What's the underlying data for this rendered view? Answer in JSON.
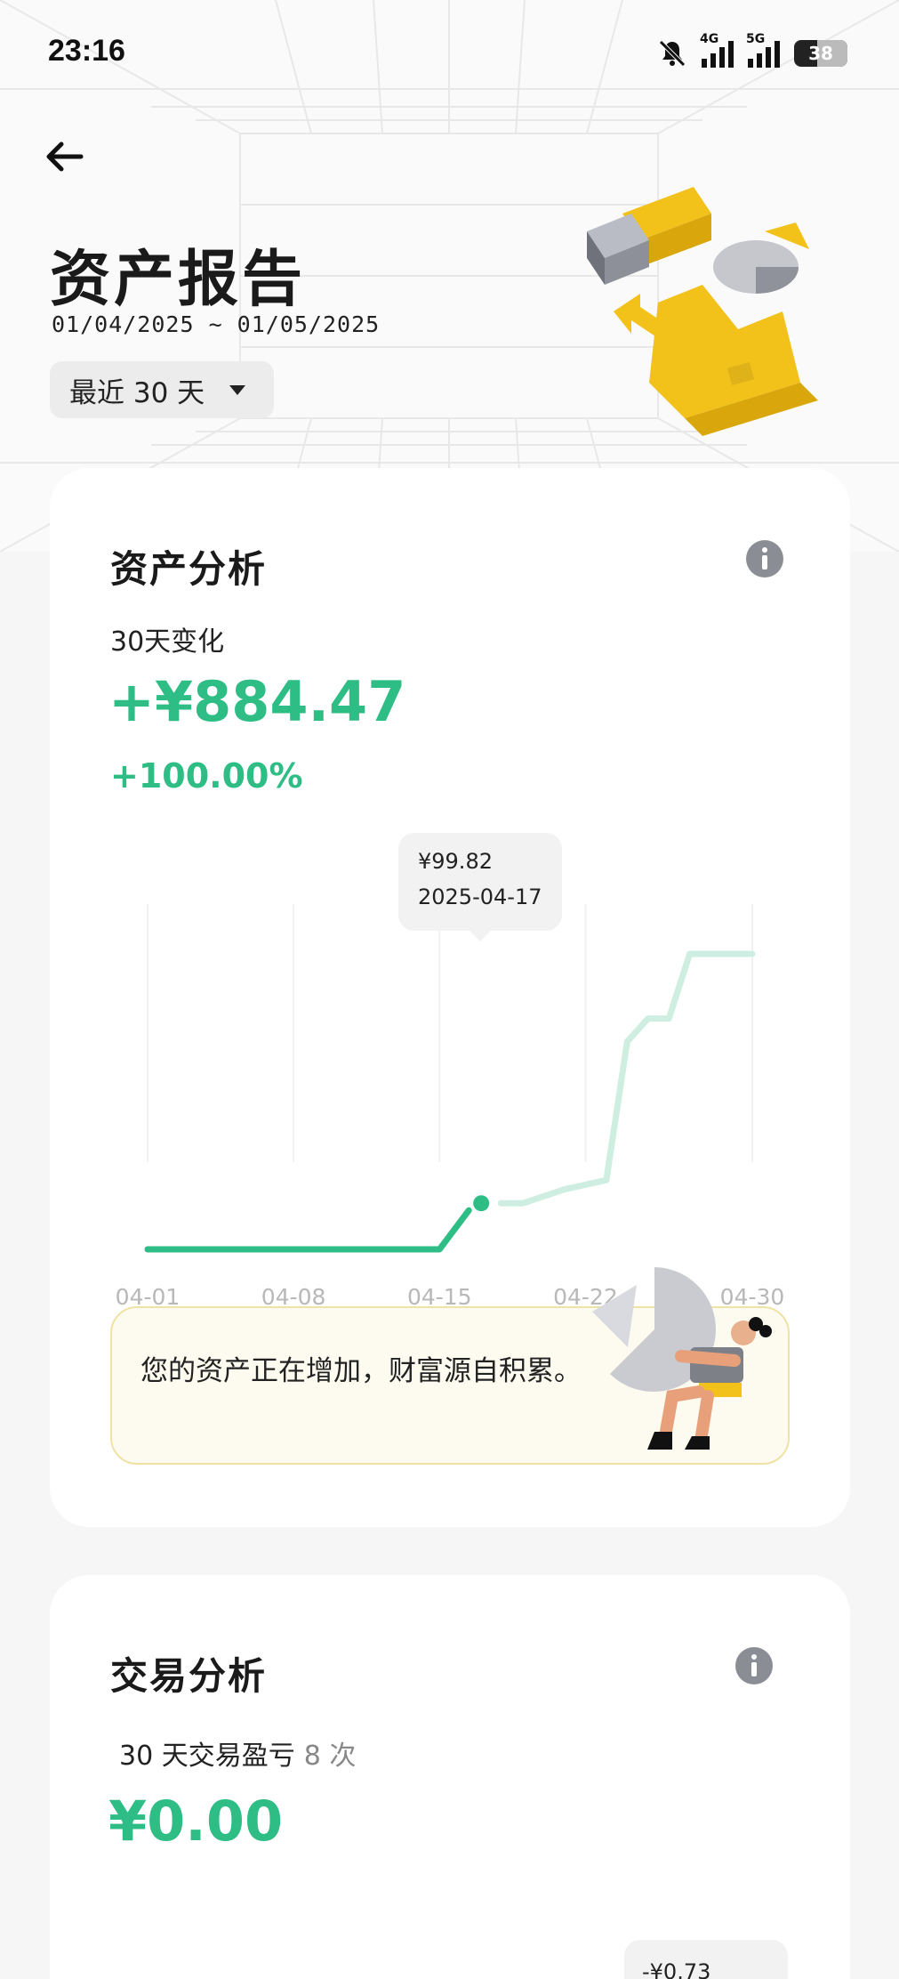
{
  "status_bar": {
    "time": "23:16",
    "network_1": "4G",
    "network_2": "5G",
    "battery": "38",
    "icons": [
      "bell-muted-icon",
      "signal-icon",
      "signal-icon",
      "battery-icon"
    ]
  },
  "header": {
    "back_icon": "arrow-left-icon",
    "title": "资产报告",
    "date_range": "01/04/2025 ~ 01/05/2025",
    "period_selector": "最近 30 天"
  },
  "asset_analysis": {
    "title": "资产分析",
    "change_label": "30天变化",
    "change_amount": "+¥884.47",
    "change_percent": "+100.00%",
    "tooltip": {
      "value": "¥99.82",
      "date": "2025-04-17"
    },
    "tip_text": "您的资产正在增加，财富源自积累。"
  },
  "chart_data": {
    "type": "line",
    "x": [
      "04-01",
      "04-03",
      "04-05",
      "04-07",
      "04-09",
      "04-11",
      "04-13",
      "04-15",
      "04-17",
      "04-19",
      "04-21",
      "04-23",
      "04-24",
      "04-25",
      "04-26",
      "04-27",
      "04-28",
      "04-29",
      "04-30"
    ],
    "series": [
      {
        "values": [
          0,
          0,
          0,
          0,
          0,
          0,
          0,
          0,
          99.82,
          99.82,
          130,
          150,
          450,
          500,
          500,
          640,
          640,
          640,
          640
        ]
      }
    ],
    "highlight": {
      "x": "04-17",
      "value": 99.82
    },
    "x_tick_labels": [
      "04-01",
      "04-08",
      "04-15",
      "04-22",
      "04-30"
    ],
    "grid": "vertical",
    "colors": {
      "line": "#2ebd85",
      "line_future": "#cdeee0"
    }
  },
  "trade_analysis": {
    "title": "交易分析",
    "pl_label": "30 天交易盈亏",
    "trade_count": "8 次",
    "pl_amount": "¥0.00",
    "chip_value": "-¥0.73"
  },
  "colors": {
    "accent_green": "#2ebd85",
    "tip_bg": "#fdfbef",
    "tip_border": "#efe2a4"
  }
}
